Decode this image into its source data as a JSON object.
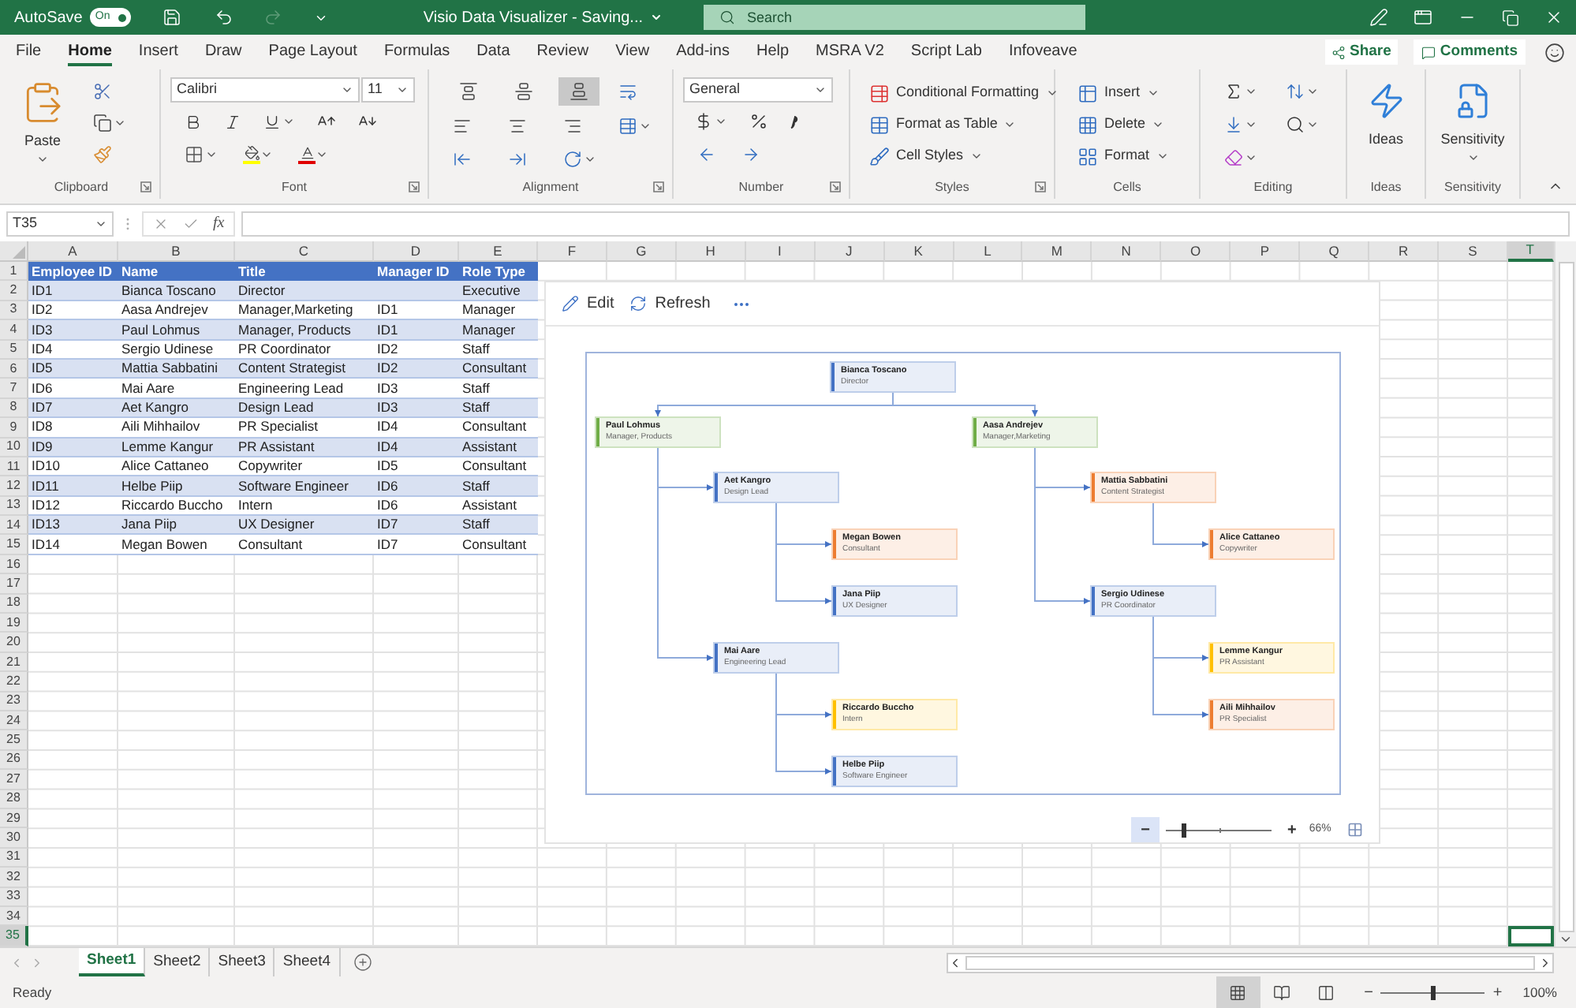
{
  "title_bar": {
    "autosave_label": "AutoSave",
    "autosave": {
      "on": true,
      "label": "On"
    },
    "redo": {
      "disabled": true
    },
    "title": "Visio Data Visualizer - Saving...",
    "search": {
      "placeholder": "Search"
    }
  },
  "menu_tabs": [
    {
      "label": "File",
      "selected": false
    },
    {
      "label": "Home",
      "selected": true
    },
    {
      "label": "Insert",
      "selected": false
    },
    {
      "label": "Draw",
      "selected": false
    },
    {
      "label": "Page Layout",
      "selected": false
    },
    {
      "label": "Formulas",
      "selected": false
    },
    {
      "label": "Data",
      "selected": false
    },
    {
      "label": "Review",
      "selected": false
    },
    {
      "label": "View",
      "selected": false
    },
    {
      "label": "Add-ins",
      "selected": false
    },
    {
      "label": "Help",
      "selected": false
    },
    {
      "label": "MSRA V2",
      "selected": false
    },
    {
      "label": "Script Lab",
      "selected": false
    },
    {
      "label": "Infoveave",
      "selected": false
    }
  ],
  "share_button": "Share",
  "comments_button": "Comments",
  "ribbon": {
    "groups": [
      {
        "kind": "clipboard",
        "label": "Clipboard",
        "paste": "Paste"
      },
      {
        "kind": "font",
        "label": "Font",
        "font_name": "Calibri",
        "font_size": "11"
      },
      {
        "kind": "alignment",
        "label": "Alignment",
        "vertical_align": [
          {
            "selected": false
          },
          {
            "selected": false
          },
          {
            "selected": true
          }
        ]
      },
      {
        "kind": "number",
        "label": "Number",
        "format": "General"
      },
      {
        "kind": "styles",
        "label": "Styles",
        "commands": [
          "Conditional Formatting",
          "Format as Table",
          "Cell Styles"
        ]
      },
      {
        "kind": "cells",
        "label": "Cells",
        "commands": [
          "Insert",
          "Delete",
          "Format"
        ]
      },
      {
        "kind": "editing",
        "label": "Editing"
      },
      {
        "kind": "ideas",
        "label": "Ideas",
        "button": "Ideas"
      },
      {
        "kind": "sensitivity",
        "label": "Sensitivity",
        "button": "Sensitivity"
      }
    ]
  },
  "formula_bar": {
    "name_box": "T35",
    "function_label": "fx"
  },
  "grid": {
    "column_letters": [
      {
        "label": "A",
        "selected": false
      },
      {
        "label": "B",
        "selected": false
      },
      {
        "label": "C",
        "selected": false
      },
      {
        "label": "D",
        "selected": false
      },
      {
        "label": "E",
        "selected": false
      },
      {
        "label": "F",
        "selected": false
      },
      {
        "label": "G",
        "selected": false
      },
      {
        "label": "H",
        "selected": false
      },
      {
        "label": "I",
        "selected": false
      },
      {
        "label": "J",
        "selected": false
      },
      {
        "label": "K",
        "selected": false
      },
      {
        "label": "L",
        "selected": false
      },
      {
        "label": "M",
        "selected": false
      },
      {
        "label": "N",
        "selected": false
      },
      {
        "label": "O",
        "selected": false
      },
      {
        "label": "P",
        "selected": false
      },
      {
        "label": "Q",
        "selected": false
      },
      {
        "label": "R",
        "selected": false
      },
      {
        "label": "S",
        "selected": false
      },
      {
        "label": "T",
        "selected": true
      }
    ],
    "row_numbers": [
      {
        "label": "1",
        "selected": false
      },
      {
        "label": "2",
        "selected": false
      },
      {
        "label": "3",
        "selected": false
      },
      {
        "label": "4",
        "selected": false
      },
      {
        "label": "5",
        "selected": false
      },
      {
        "label": "6",
        "selected": false
      },
      {
        "label": "7",
        "selected": false
      },
      {
        "label": "8",
        "selected": false
      },
      {
        "label": "9",
        "selected": false
      },
      {
        "label": "10",
        "selected": false
      },
      {
        "label": "11",
        "selected": false
      },
      {
        "label": "12",
        "selected": false
      },
      {
        "label": "13",
        "selected": false
      },
      {
        "label": "14",
        "selected": false
      },
      {
        "label": "15",
        "selected": false
      },
      {
        "label": "16",
        "selected": false
      },
      {
        "label": "17",
        "selected": false
      },
      {
        "label": "18",
        "selected": false
      },
      {
        "label": "19",
        "selected": false
      },
      {
        "label": "20",
        "selected": false
      },
      {
        "label": "21",
        "selected": false
      },
      {
        "label": "22",
        "selected": false
      },
      {
        "label": "23",
        "selected": false
      },
      {
        "label": "24",
        "selected": false
      },
      {
        "label": "25",
        "selected": false
      },
      {
        "label": "26",
        "selected": false
      },
      {
        "label": "27",
        "selected": false
      },
      {
        "label": "28",
        "selected": false
      },
      {
        "label": "29",
        "selected": false
      },
      {
        "label": "30",
        "selected": false
      },
      {
        "label": "31",
        "selected": false
      },
      {
        "label": "32",
        "selected": false
      },
      {
        "label": "33",
        "selected": false
      },
      {
        "label": "34",
        "selected": false
      },
      {
        "label": "35",
        "selected": true
      }
    ]
  },
  "table": {
    "columns": [
      "Employee ID",
      "Name",
      "Title",
      "Manager ID",
      "Role Type"
    ],
    "rows": [
      [
        "ID1",
        "Bianca Toscano",
        "Director",
        "",
        "Executive"
      ],
      [
        "ID2",
        "Aasa Andrejev",
        "Manager,Marketing",
        "ID1",
        "Manager"
      ],
      [
        "ID3",
        "Paul Lohmus",
        "Manager, Products",
        "ID1",
        "Manager"
      ],
      [
        "ID4",
        "Sergio Udinese",
        "PR Coordinator",
        "ID2",
        "Staff"
      ],
      [
        "ID5",
        "Mattia Sabbatini",
        "Content Strategist",
        "ID2",
        "Consultant"
      ],
      [
        "ID6",
        "Mai Aare",
        "Engineering Lead",
        "ID3",
        "Staff"
      ],
      [
        "ID7",
        "Aet Kangro",
        "Design Lead",
        "ID3",
        "Staff"
      ],
      [
        "ID8",
        "Aili Mihhailov",
        "PR Specialist",
        "ID4",
        "Consultant"
      ],
      [
        "ID9",
        "Lemme Kangur",
        "PR Assistant",
        "ID4",
        "Assistant"
      ],
      [
        "ID10",
        "Alice Cattaneo",
        "Copywriter",
        "ID5",
        "Consultant"
      ],
      [
        "ID11",
        "Helbe Piip",
        "Software Engineer",
        "ID6",
        "Staff"
      ],
      [
        "ID12",
        "Riccardo Buccho",
        "Intern",
        "ID6",
        "Assistant"
      ],
      [
        "ID13",
        "Jana Piip",
        "UX Designer",
        "ID7",
        "Staff"
      ],
      [
        "ID14",
        "Megan Bowen",
        "Consultant",
        "ID7",
        "Consultant"
      ]
    ]
  },
  "visual": {
    "toolbar": {
      "edit": "Edit",
      "refresh": "Refresh"
    },
    "org_chart": {
      "name": "Bianca Toscano",
      "title": "Director",
      "color": "#4472c4",
      "children": [
        {
          "name": "Paul Lohmus",
          "title": "Manager, Products",
          "color": "#70ad47",
          "children": [
            {
              "name": "Aet Kangro",
              "title": "Design Lead",
              "color": "#4472c4",
              "children": [
                {
                  "name": "Megan Bowen",
                  "title": "Consultant",
                  "color": "#ed7d31"
                },
                {
                  "name": "Jana Piip",
                  "title": "UX Designer",
                  "color": "#4472c4"
                }
              ]
            },
            {
              "name": "Mai Aare",
              "title": "Engineering Lead",
              "color": "#4472c4",
              "children": [
                {
                  "name": "Riccardo Buccho",
                  "title": "Intern",
                  "color": "#ffc000"
                },
                {
                  "name": "Helbe Piip",
                  "title": "Software Engineer",
                  "color": "#4472c4"
                }
              ]
            }
          ]
        },
        {
          "name": "Aasa Andrejev",
          "title": "Manager,Marketing",
          "color": "#70ad47",
          "children": [
            {
              "name": "Mattia Sabbatini",
              "title": "Content Strategist",
              "color": "#ed7d31",
              "children": [
                {
                  "name": "Alice Cattaneo",
                  "title": "Copywriter",
                  "color": "#ed7d31"
                }
              ]
            },
            {
              "name": "Sergio Udinese",
              "title": "PR Coordinator",
              "color": "#4472c4",
              "children": [
                {
                  "name": "Lemme Kangur",
                  "title": "PR Assistant",
                  "color": "#ffc000"
                },
                {
                  "name": "Aili Mihhailov",
                  "title": "PR Specialist",
                  "color": "#ed7d31"
                }
              ]
            }
          ]
        }
      ]
    },
    "zoom": {
      "zoom_out": "−",
      "zoom_in": "+",
      "level": 0.17,
      "reading": "66%"
    }
  },
  "sheet_tabs": [
    {
      "label": "Sheet1",
      "selected": true
    },
    {
      "label": "Sheet2",
      "selected": false
    },
    {
      "label": "Sheet3",
      "selected": false
    },
    {
      "label": "Sheet4",
      "selected": false
    }
  ],
  "status_bar": {
    "status": "Ready",
    "views": [
      {
        "selected": true
      },
      {
        "selected": false
      },
      {
        "selected": false
      }
    ],
    "zoom": {
      "zoom_out": "−",
      "zoom_in": "+",
      "level": 0.5,
      "reading": "100%"
    }
  }
}
